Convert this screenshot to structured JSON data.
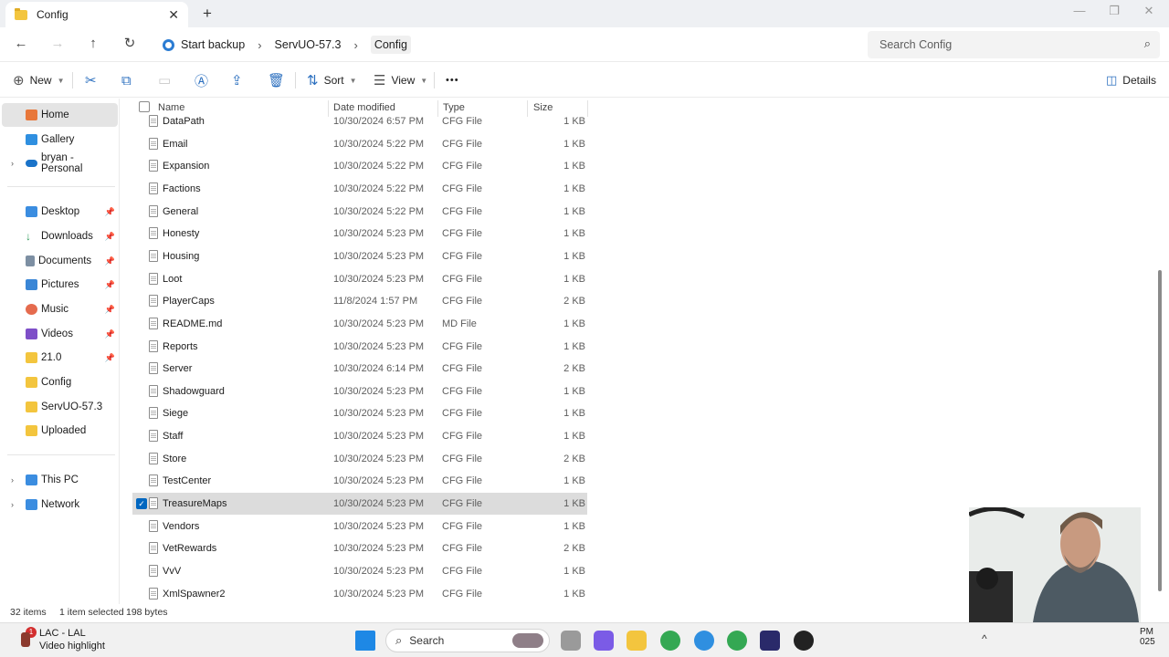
{
  "window": {
    "tab_title": "Config",
    "newtab": "+",
    "close": "✕"
  },
  "nav": {
    "breadcrumbs": [
      "Start backup",
      "ServUO-57.3",
      "Config"
    ],
    "search_placeholder": "Search Config"
  },
  "toolbar": {
    "new_label": "New",
    "sort_label": "Sort",
    "view_label": "View",
    "more_label": "•••",
    "details_label": "Details"
  },
  "sidebar": {
    "top": [
      {
        "label": "Home",
        "icon": "home-icon",
        "selected": true
      },
      {
        "label": "Gallery",
        "icon": "gallery-icon"
      },
      {
        "label": "bryan - Personal",
        "icon": "onedrive-icon",
        "expandable": true
      }
    ],
    "quick": [
      {
        "label": "Desktop",
        "icon": "desktop-icon",
        "color": "#3b8de0"
      },
      {
        "label": "Downloads",
        "icon": "downloads-icon",
        "color": "#2e9a5a"
      },
      {
        "label": "Documents",
        "icon": "documents-icon",
        "color": "#7d8fa3"
      },
      {
        "label": "Pictures",
        "icon": "pictures-icon",
        "color": "#3a86d6"
      },
      {
        "label": "Music",
        "icon": "music-icon",
        "color": "#e56b4e"
      },
      {
        "label": "Videos",
        "icon": "videos-icon",
        "color": "#7e4fc8"
      },
      {
        "label": "21.0",
        "icon": "folder-icon",
        "color": "#f3c53e"
      },
      {
        "label": "Config",
        "icon": "folder-icon",
        "color": "#f3c53e"
      },
      {
        "label": "ServUO-57.3",
        "icon": "folder-icon",
        "color": "#f3c53e"
      },
      {
        "label": "Uploaded",
        "icon": "folder-icon",
        "color": "#f3c53e"
      }
    ],
    "bottom": [
      {
        "label": "This PC",
        "icon": "pc-icon",
        "color": "#3b8de0"
      },
      {
        "label": "Network",
        "icon": "network-icon",
        "color": "#3b8de0"
      }
    ]
  },
  "columns": {
    "name": "Name",
    "date": "Date modified",
    "type": "Type",
    "size": "Size"
  },
  "files": [
    {
      "name": "DataPath",
      "date": "10/30/2024 6:57 PM",
      "type": "CFG File",
      "size": "1 KB"
    },
    {
      "name": "Email",
      "date": "10/30/2024 5:22 PM",
      "type": "CFG File",
      "size": "1 KB"
    },
    {
      "name": "Expansion",
      "date": "10/30/2024 5:22 PM",
      "type": "CFG File",
      "size": "1 KB"
    },
    {
      "name": "Factions",
      "date": "10/30/2024 5:22 PM",
      "type": "CFG File",
      "size": "1 KB"
    },
    {
      "name": "General",
      "date": "10/30/2024 5:22 PM",
      "type": "CFG File",
      "size": "1 KB"
    },
    {
      "name": "Honesty",
      "date": "10/30/2024 5:23 PM",
      "type": "CFG File",
      "size": "1 KB"
    },
    {
      "name": "Housing",
      "date": "10/30/2024 5:23 PM",
      "type": "CFG File",
      "size": "1 KB"
    },
    {
      "name": "Loot",
      "date": "10/30/2024 5:23 PM",
      "type": "CFG File",
      "size": "1 KB"
    },
    {
      "name": "PlayerCaps",
      "date": "11/8/2024 1:57 PM",
      "type": "CFG File",
      "size": "2 KB"
    },
    {
      "name": "README.md",
      "date": "10/30/2024 5:23 PM",
      "type": "MD File",
      "size": "1 KB"
    },
    {
      "name": "Reports",
      "date": "10/30/2024 5:23 PM",
      "type": "CFG File",
      "size": "1 KB"
    },
    {
      "name": "Server",
      "date": "10/30/2024 6:14 PM",
      "type": "CFG File",
      "size": "2 KB"
    },
    {
      "name": "Shadowguard",
      "date": "10/30/2024 5:23 PM",
      "type": "CFG File",
      "size": "1 KB"
    },
    {
      "name": "Siege",
      "date": "10/30/2024 5:23 PM",
      "type": "CFG File",
      "size": "1 KB"
    },
    {
      "name": "Staff",
      "date": "10/30/2024 5:23 PM",
      "type": "CFG File",
      "size": "1 KB"
    },
    {
      "name": "Store",
      "date": "10/30/2024 5:23 PM",
      "type": "CFG File",
      "size": "2 KB"
    },
    {
      "name": "TestCenter",
      "date": "10/30/2024 5:23 PM",
      "type": "CFG File",
      "size": "1 KB"
    },
    {
      "name": "TreasureMaps",
      "date": "10/30/2024 5:23 PM",
      "type": "CFG File",
      "size": "1 KB",
      "selected": true
    },
    {
      "name": "Vendors",
      "date": "10/30/2024 5:23 PM",
      "type": "CFG File",
      "size": "1 KB"
    },
    {
      "name": "VetRewards",
      "date": "10/30/2024 5:23 PM",
      "type": "CFG File",
      "size": "2 KB"
    },
    {
      "name": "VvV",
      "date": "10/30/2024 5:23 PM",
      "type": "CFG File",
      "size": "1 KB"
    },
    {
      "name": "XmlSpawner2",
      "date": "10/30/2024 5:23 PM",
      "type": "CFG File",
      "size": "1 KB"
    }
  ],
  "status": {
    "items": "32 items",
    "selected": "1 item selected",
    "bytes": "198 bytes"
  },
  "taskbar": {
    "notification_title": "LAC - LAL",
    "notification_sub": "Video highlight",
    "notification_badge": "1",
    "search_label": "Search",
    "clock_time": "PM",
    "clock_date": "025"
  },
  "colors": {
    "accent": "#0067c0",
    "folder": "#f3c53e",
    "selected_row": "#dcdcdc"
  }
}
